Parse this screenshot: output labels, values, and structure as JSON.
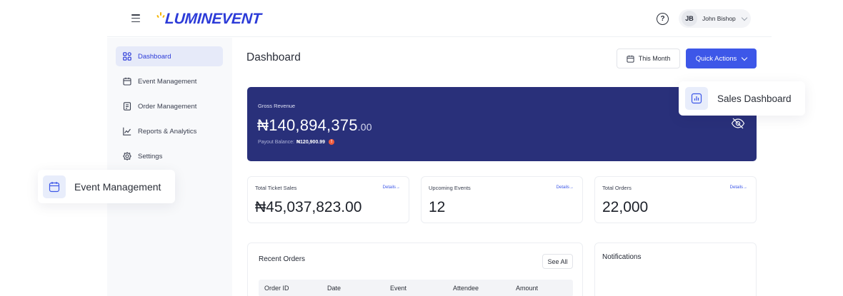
{
  "header": {
    "logo_text": "LUMINEVENT",
    "help_glyph": "?",
    "user": {
      "initials": "JB",
      "name": "John Bishop"
    }
  },
  "sidebar": {
    "items": [
      {
        "label": "Dashboard",
        "icon": "grid-icon",
        "active": true
      },
      {
        "label": "Event Management",
        "icon": "calendar-icon"
      },
      {
        "label": "Order Management",
        "icon": "receipt-icon"
      },
      {
        "label": "Reports & Analytics",
        "icon": "chart-line-icon"
      },
      {
        "label": "Settings",
        "icon": "gear-icon"
      }
    ]
  },
  "main": {
    "title": "Dashboard",
    "period_button": "This Month",
    "quick_actions_button": "Quick Actions"
  },
  "revenue": {
    "label": "Gross Revenue",
    "amount": "₦140,894,375",
    "cents": ".00",
    "payout_label": "Payout Balance:",
    "payout_value": "₦120,900.99",
    "alert_glyph": "!"
  },
  "stats": [
    {
      "label": "Total Ticket Sales",
      "link": "Details→",
      "value": "₦45,037,823.00"
    },
    {
      "label": "Upcoming Events",
      "link": "Details→",
      "value": "12"
    },
    {
      "label": "Total Orders",
      "link": "Details→",
      "value": "22,000"
    }
  ],
  "orders": {
    "title": "Recent Orders",
    "see_all": "See All",
    "columns": [
      "Order ID",
      "Date",
      "Event",
      "Attendee",
      "Amount"
    ]
  },
  "notifications": {
    "title": "Notifications"
  },
  "floating": {
    "sales_dashboard": "Sales Dashboard",
    "event_management": "Event Management"
  },
  "colors": {
    "brand": "#2c3bd8",
    "primary_button": "#3d57e8",
    "revenue_card": "#29307a",
    "alert": "#ef5a3c"
  }
}
